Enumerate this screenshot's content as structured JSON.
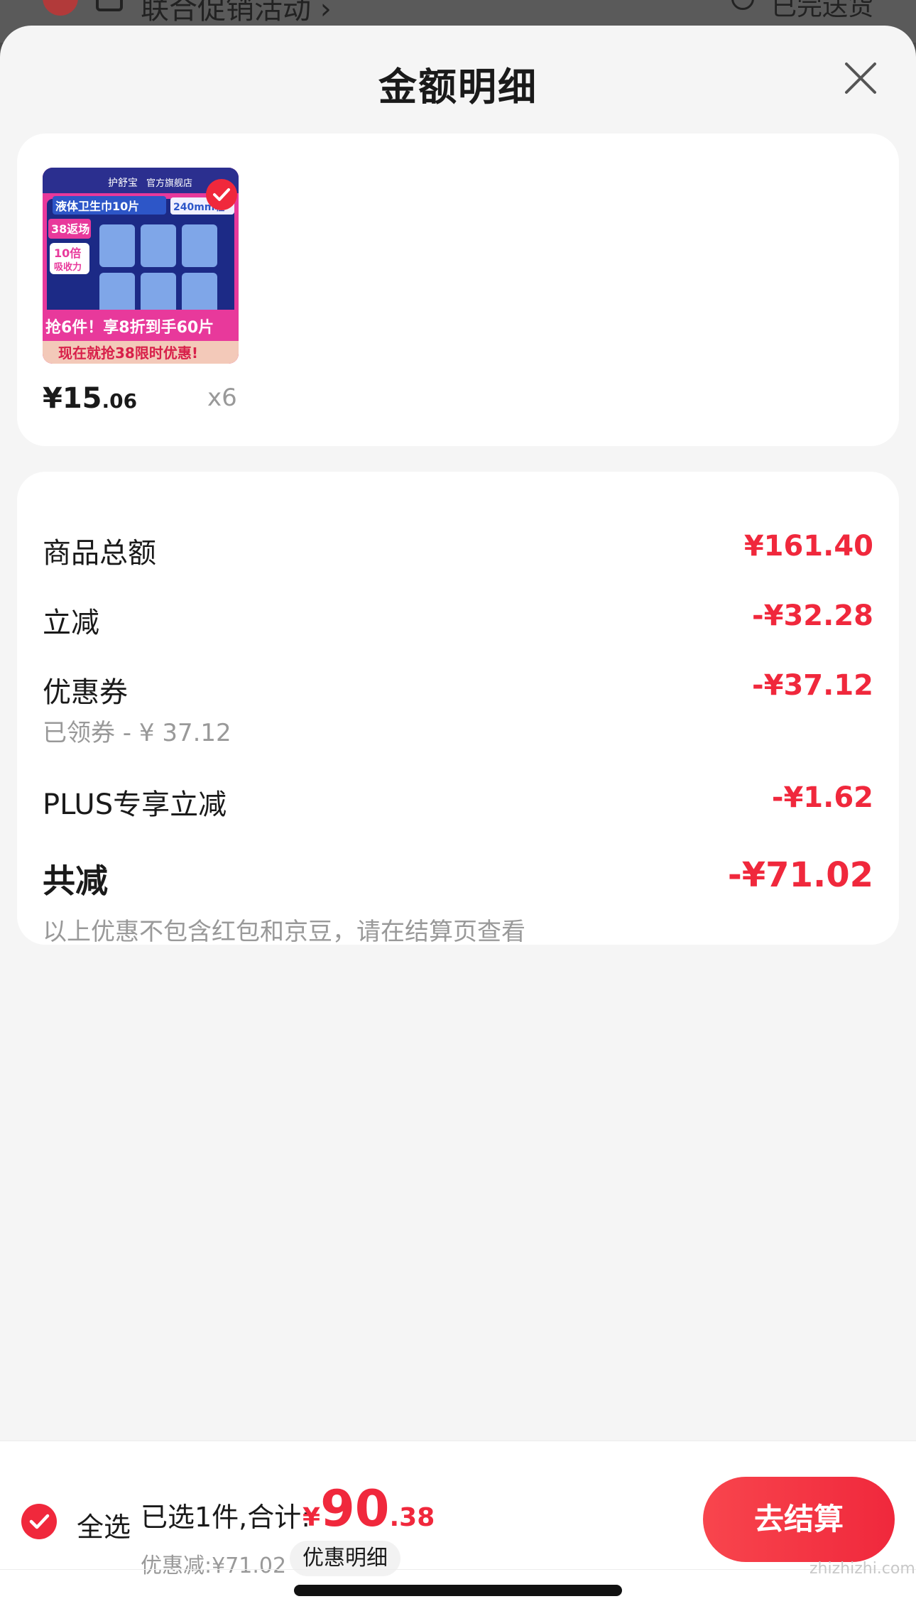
{
  "behind": {
    "title": "联合促销活动 ›",
    "right_text": "已完送货"
  },
  "sheet": {
    "title": "金额明细"
  },
  "product": {
    "price_symbol": "¥",
    "price_int": "15",
    "price_dec": ".06",
    "quantity": "x6",
    "thumbnail": {
      "brand": "护舒宝",
      "store": "官方旗舰店",
      "line1": "液体卫生巾10片",
      "line2": "240mm轻",
      "badge": "38返场",
      "feature_big": "10倍",
      "feature_small": "吸收力",
      "promo": "抢6件！享8折到手60片",
      "banner": "现在就抢38限时优惠!"
    }
  },
  "details": {
    "rows": [
      {
        "label": "商品总额",
        "amount": "¥161.40"
      },
      {
        "label": "立减",
        "amount": "-¥32.28"
      },
      {
        "label": "优惠券",
        "amount": "-¥37.12",
        "sub": "已领券 - ¥ 37.12"
      },
      {
        "label": "PLUS专享立减",
        "amount": "-¥1.62"
      },
      {
        "label": "共减",
        "amount": "-¥71.02",
        "sub": "以上优惠不包含红包和京豆，请在结算页查看"
      }
    ]
  },
  "footer": {
    "select_all": "全选",
    "selected_info": "已选1件,合计:",
    "total_symbol": "¥",
    "total_int": "90",
    "total_dec": ".38",
    "discount": "优惠减:¥71.02",
    "discount_detail_button": "优惠明细",
    "checkout_button": "去结算"
  },
  "watermark": "zhizhizhi.com",
  "colors": {
    "accent": "#f0283c",
    "sheet_bg": "#f5f5f5",
    "card_bg": "#ffffff",
    "muted_text": "#999999"
  },
  "icons": {
    "close": "close-icon",
    "check": "check-icon"
  }
}
